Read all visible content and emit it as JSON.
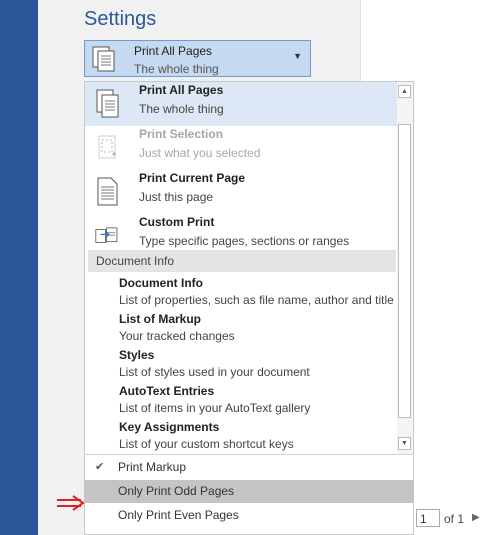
{
  "settings": {
    "title": "Settings"
  },
  "selector": {
    "title": "Print All Pages",
    "description": "The whole thing",
    "icon": "document-pages-icon"
  },
  "print_options": [
    {
      "title": "Print All Pages",
      "description": "The whole thing",
      "state": "selected",
      "icon": "document-pages-icon"
    },
    {
      "title": "Print Selection",
      "description": "Just what you selected",
      "state": "disabled",
      "icon": "selection-icon"
    },
    {
      "title": "Print Current Page",
      "description": "Just this page",
      "state": "normal",
      "icon": "single-page-icon"
    },
    {
      "title": "Custom Print",
      "description": "Type specific pages, sections or ranges",
      "state": "normal",
      "icon": "custom-print-icon"
    }
  ],
  "document_info": {
    "header": "Document Info",
    "items": [
      {
        "title": "Document Info",
        "description": "List of properties, such as file name, author and title"
      },
      {
        "title": "List of Markup",
        "description": "Your tracked changes"
      },
      {
        "title": "Styles",
        "description": "List of styles used in your document"
      },
      {
        "title": "AutoText Entries",
        "description": "List of items in your AutoText gallery"
      },
      {
        "title": "Key Assignments",
        "description": "List of your custom shortcut keys"
      }
    ]
  },
  "toggles": [
    {
      "label": "Print Markup",
      "checked": true,
      "check_glyph": "✔"
    },
    {
      "label": "Only Print Odd Pages",
      "checked": false,
      "highlighted": true
    },
    {
      "label": "Only Print Even Pages",
      "checked": false
    }
  ],
  "page_nav": {
    "current": "1",
    "of_label": "of 1"
  },
  "colors": {
    "accent": "#2b579a",
    "selected": "#c5d9f1",
    "hover": "#c4c4c4",
    "annotation": "#e02020"
  }
}
